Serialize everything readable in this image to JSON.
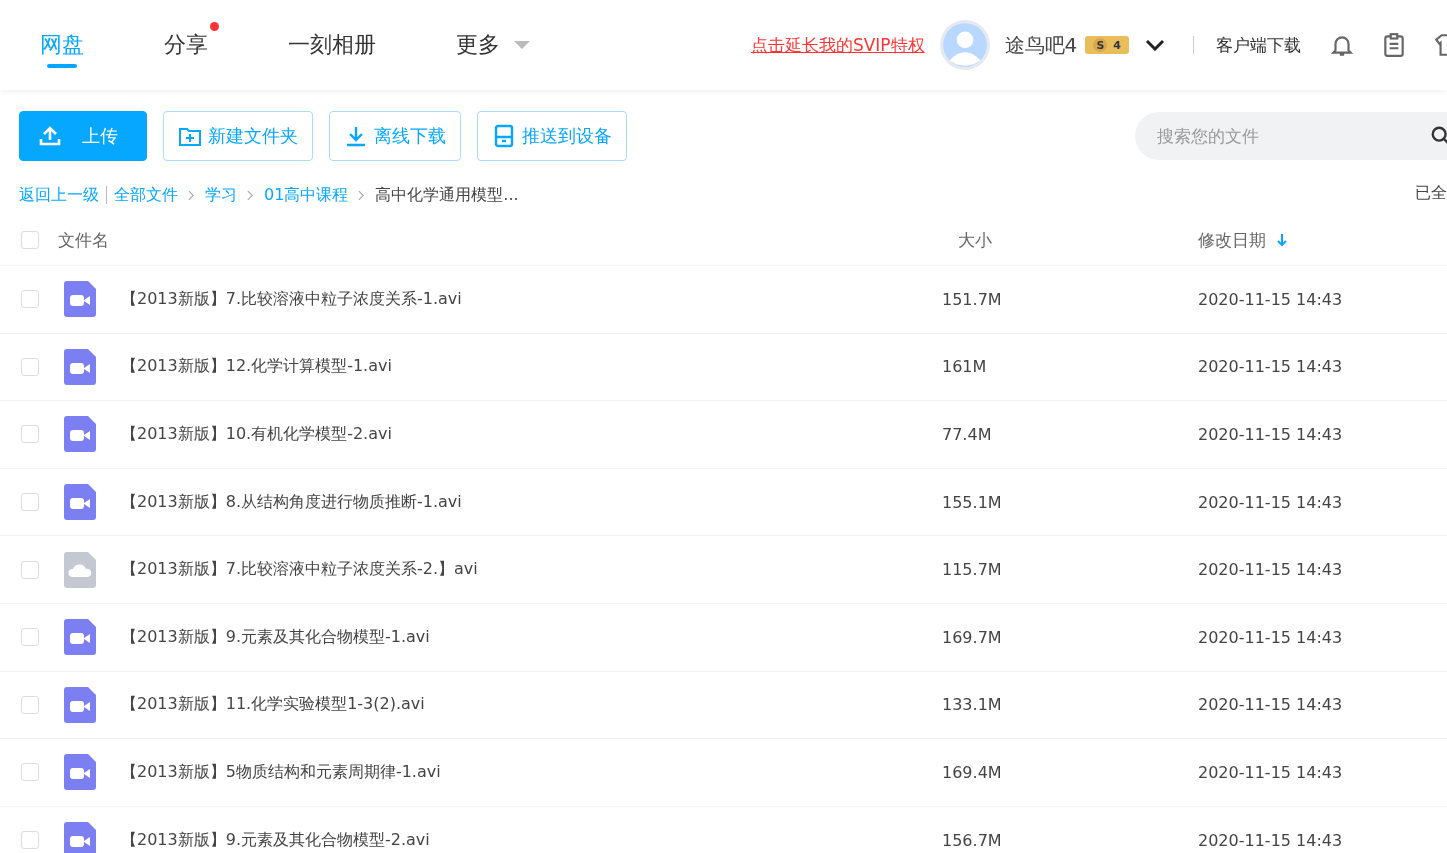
{
  "nav": {
    "tabs": [
      {
        "label": "网盘",
        "selected": true,
        "dot": false,
        "caret": false
      },
      {
        "label": "分享",
        "selected": false,
        "dot": true,
        "caret": false
      },
      {
        "label": "一刻相册",
        "selected": false,
        "dot": false,
        "caret": false
      },
      {
        "label": "更多",
        "selected": false,
        "dot": false,
        "caret": true
      }
    ],
    "promo_link": "点击延长我的SVIP特权",
    "username": "途鸟吧4",
    "vip_tier": "S",
    "vip_level": "4",
    "client_download": "客户端下载"
  },
  "toolbar": {
    "buttons": [
      {
        "label": "上传",
        "kind": "upload",
        "primary": true
      },
      {
        "label": "新建文件夹",
        "kind": "folder",
        "primary": false
      },
      {
        "label": "离线下载",
        "kind": "download",
        "primary": false
      },
      {
        "label": "推送到设备",
        "kind": "device",
        "primary": false
      }
    ],
    "search": {
      "placeholder": "搜索您的文件"
    }
  },
  "breadcrumb": {
    "back": "返回上一级",
    "items": [
      "全部文件",
      "学习",
      "01高中课程"
    ],
    "current": "高中化学通用模型...",
    "right_text": "已全"
  },
  "table": {
    "select_all_checked": false,
    "columns": [
      "文件名",
      "大小",
      "修改日期"
    ],
    "rows": [
      {
        "name": "【2013新版】7.比较溶液中粒子浓度关系-1.avi",
        "size": "151.7M",
        "date": "2020-11-15 14:43",
        "kind": "video",
        "checked": false
      },
      {
        "name": "【2013新版】12.化学计算模型-1.avi",
        "size": "161M",
        "date": "2020-11-15 14:43",
        "kind": "video",
        "checked": false
      },
      {
        "name": "【2013新版】10.有机化学模型-2.avi",
        "size": "77.4M",
        "date": "2020-11-15 14:43",
        "kind": "video",
        "checked": false
      },
      {
        "name": "【2013新版】8.从结构角度进行物质推断-1.avi",
        "size": "155.1M",
        "date": "2020-11-15 14:43",
        "kind": "video",
        "checked": false
      },
      {
        "name": "【2013新版】7.比较溶液中粒子浓度关系-2.】avi",
        "size": "115.7M",
        "date": "2020-11-15 14:43",
        "kind": "cloud",
        "checked": false
      },
      {
        "name": "【2013新版】9.元素及其化合物模型-1.avi",
        "size": "169.7M",
        "date": "2020-11-15 14:43",
        "kind": "video",
        "checked": false
      },
      {
        "name": "【2013新版】11.化学实验模型1-3(2).avi",
        "size": "133.1M",
        "date": "2020-11-15 14:43",
        "kind": "video",
        "checked": false
      },
      {
        "name": "【2013新版】5物质结构和元素周期律-1.avi",
        "size": "169.4M",
        "date": "2020-11-15 14:43",
        "kind": "video",
        "checked": false
      },
      {
        "name": "【2013新版】9.元素及其化合物模型-2.avi",
        "size": "156.7M",
        "date": "2020-11-15 14:43",
        "kind": "video",
        "checked": false
      }
    ]
  }
}
